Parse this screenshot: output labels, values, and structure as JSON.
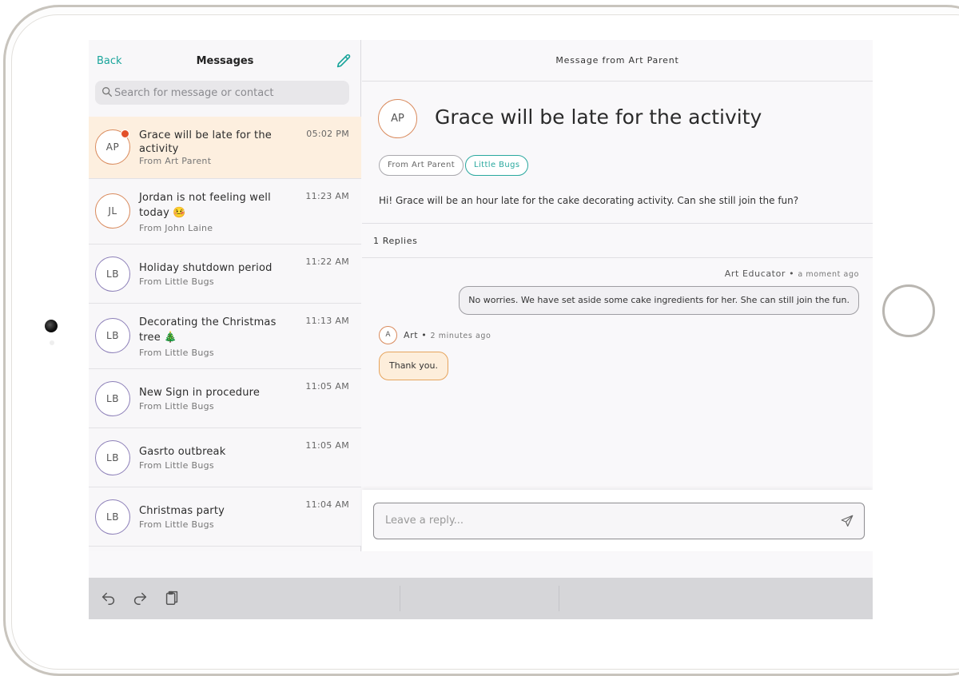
{
  "left_pane": {
    "back_label": "Back",
    "title": "Messages",
    "search_placeholder": "Search for message or contact",
    "messages": [
      {
        "initials": "AP",
        "title": "Grace will be late for the activity",
        "from": "From Art Parent",
        "time": "05:02 PM",
        "unread": true,
        "selected": true
      },
      {
        "initials": "JL",
        "title": "Jordan is not feeling well today 🤒",
        "from": "From John Laine",
        "time": "11:23 AM"
      },
      {
        "initials": "LB",
        "title": "Holiday shutdown period",
        "from": "From Little Bugs",
        "time": "11:22 AM"
      },
      {
        "initials": "LB",
        "title": "Decorating the Christmas tree 🎄",
        "from": "From Little Bugs",
        "time": "11:13 AM"
      },
      {
        "initials": "LB",
        "title": "New Sign in procedure",
        "from": "From Little Bugs",
        "time": "11:05 AM"
      },
      {
        "initials": "LB",
        "title": "Gasrto outbreak",
        "from": "From Little Bugs",
        "time": "11:05 AM"
      },
      {
        "initials": "LB",
        "title": "Christmas party",
        "from": "From Little Bugs",
        "time": "11:04 AM"
      }
    ]
  },
  "detail": {
    "header": "Message from Art Parent",
    "avatar": "AP",
    "title": "Grace will be late for the activity",
    "tags": [
      "From Art Parent",
      "Little Bugs"
    ],
    "body": "Hi! Grace will be an hour late for the cake decorating activity. Can she still join the fun?",
    "replies_count": "1 Replies",
    "replies": [
      {
        "author": "Art Educator",
        "ago": "a moment ago",
        "text": "No worries. We have set aside some cake ingredients for her. She can still join the fun."
      },
      {
        "avatar": "A",
        "author": "Art",
        "ago": "2 minutes ago",
        "text": "Thank you."
      }
    ],
    "reply_placeholder": "Leave a reply..."
  },
  "colors": {
    "accent_teal": "#1aa59b",
    "unread_dot": "#e2502a",
    "selected_row": "#fdefdf",
    "parent_bubble": "#fdeedb"
  },
  "icons": [
    "edit-icon",
    "search-icon",
    "send-icon",
    "undo-icon",
    "redo-icon",
    "clipboard-icon"
  ]
}
